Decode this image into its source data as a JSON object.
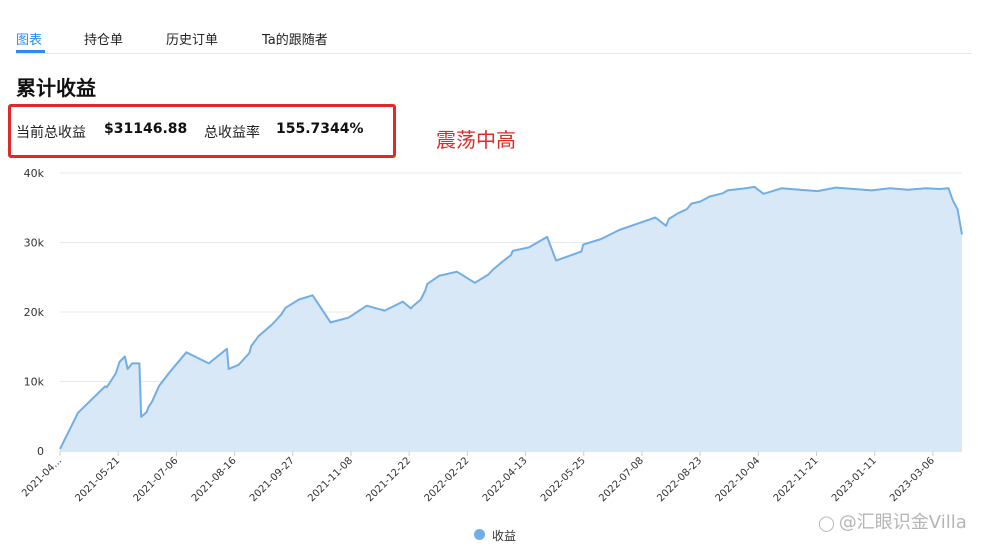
{
  "tabs": [
    {
      "label": "图表",
      "active": true
    },
    {
      "label": "持仓单",
      "active": false
    },
    {
      "label": "历史订单",
      "active": false
    },
    {
      "label": "Ta的跟随者",
      "active": false
    }
  ],
  "title": "累计收益",
  "summary": {
    "current_label": "当前总收益",
    "current_value": "$31146.88",
    "rate_label": "总收益率",
    "rate_value": "155.7344%"
  },
  "annotation": "震荡中高",
  "watermark": "@汇眼识金Villa",
  "colors": {
    "accent": "#2d8cf0",
    "line": "#72aee6",
    "area": "#d9e8f7",
    "highlight": "#e02a2a"
  },
  "chart_data": {
    "type": "area",
    "ylim": [
      0,
      40000
    ],
    "y_ticks": [
      "0",
      "10k",
      "20k",
      "30k",
      "40k"
    ],
    "x_ticks": [
      "2021-04...",
      "2021-05-21",
      "2021-07-06",
      "2021-08-16",
      "2021-09-27",
      "2021-11-08",
      "2021-12-22",
      "2022-02-22",
      "2022-04-13",
      "2022-05-25",
      "2022-07-08",
      "2022-08-23",
      "2022-10-04",
      "2022-11-21",
      "2023-01-11",
      "2023-03-06"
    ],
    "grid": true,
    "legend_position": "bottom",
    "series": [
      {
        "name": "收益",
        "x": [
          0,
          0.02,
          0.05,
          0.052,
          0.062,
          0.066,
          0.072,
          0.075,
          0.08,
          0.088,
          0.09,
          0.096,
          0.098,
          0.102,
          0.11,
          0.122,
          0.14,
          0.165,
          0.185,
          0.187,
          0.198,
          0.21,
          0.212,
          0.22,
          0.235,
          0.245,
          0.25,
          0.265,
          0.28,
          0.3,
          0.32,
          0.34,
          0.36,
          0.38,
          0.389,
          0.391,
          0.4,
          0.405,
          0.407,
          0.42,
          0.44,
          0.46,
          0.475,
          0.48,
          0.49,
          0.5,
          0.502,
          0.52,
          0.54,
          0.55,
          0.578,
          0.58,
          0.6,
          0.62,
          0.64,
          0.66,
          0.672,
          0.675,
          0.685,
          0.695,
          0.7,
          0.71,
          0.72,
          0.735,
          0.74,
          0.76,
          0.77,
          0.78,
          0.8,
          0.82,
          0.84,
          0.86,
          0.88,
          0.9,
          0.92,
          0.94,
          0.96,
          0.975,
          0.985,
          0.99,
          0.995,
          1
        ],
        "values": [
          300,
          5500,
          9300,
          9200,
          11200,
          12800,
          13600,
          11800,
          12600,
          12600,
          4900,
          5600,
          6300,
          7100,
          9400,
          11400,
          14200,
          12600,
          14700,
          11800,
          12400,
          14100,
          15100,
          16500,
          18200,
          19600,
          20600,
          21800,
          22400,
          18500,
          19200,
          20900,
          20200,
          21500,
          20500,
          20800,
          21800,
          23100,
          24000,
          25200,
          25800,
          24200,
          25400,
          26100,
          27200,
          28200,
          28800,
          29300,
          30800,
          27400,
          28700,
          29700,
          30500,
          31800,
          32700,
          33600,
          32400,
          33400,
          34200,
          34800,
          35600,
          35900,
          36600,
          37100,
          37500,
          37800,
          38000,
          37000,
          37800,
          37600,
          37400,
          37900,
          37700,
          37500,
          37800,
          37600,
          37800,
          37700,
          37800,
          36000,
          34800,
          31146.88
        ]
      }
    ]
  }
}
